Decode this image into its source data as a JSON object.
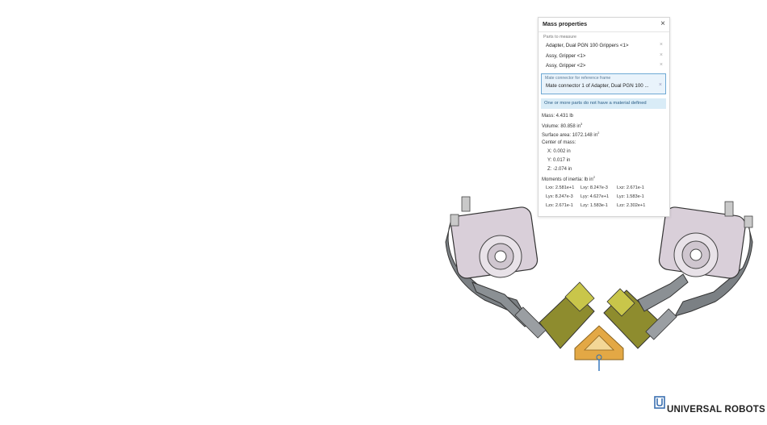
{
  "panel": {
    "title": "Mass properties",
    "parts_label": "Parts to measure",
    "parts": [
      "Adapter, Dual PGN 100 Grippers <1>",
      "Assy, Gripper <1>",
      "Assy, Gripper <2>"
    ],
    "mate_label": "Mate connector for reference frame",
    "mate_value": "Mate connector 1 of Adapter, Dual PGN 100 ...",
    "notice": "One or more parts do not have a material defined",
    "mass": "Mass: 4.431 lb",
    "volume": "Volume: 80.858 in",
    "surface": "Surface area: 1072.148 in",
    "center_label": "Center of mass:",
    "cx": "X: 0.002 in",
    "cy": "Y: 0.017 in",
    "cz": "Z: -2.074 in",
    "moments_label": "Moments of inertia: lb in",
    "moments": [
      [
        "Lxx: 2.581e+1",
        "Lxy: 8.247e-3",
        "Lxz: 2.671e-1"
      ],
      [
        "Lyx: 8.247e-3",
        "Lyy: 4.627e+1",
        "Lyz: 1.583e-1"
      ],
      [
        "Lzx: 2.671e-1",
        "Lzy: 1.583e-1",
        "Lzz: 2.302e+1"
      ]
    ]
  },
  "logo": {
    "text": "UNIVERSAL ROBOTS"
  },
  "colors": {
    "gripper_body": "#d6ccd6",
    "bracket": "#555b5f",
    "jaw": "#8a8a2a",
    "adapter": "#e0a640",
    "accent_blue": "#2a6fb8"
  }
}
